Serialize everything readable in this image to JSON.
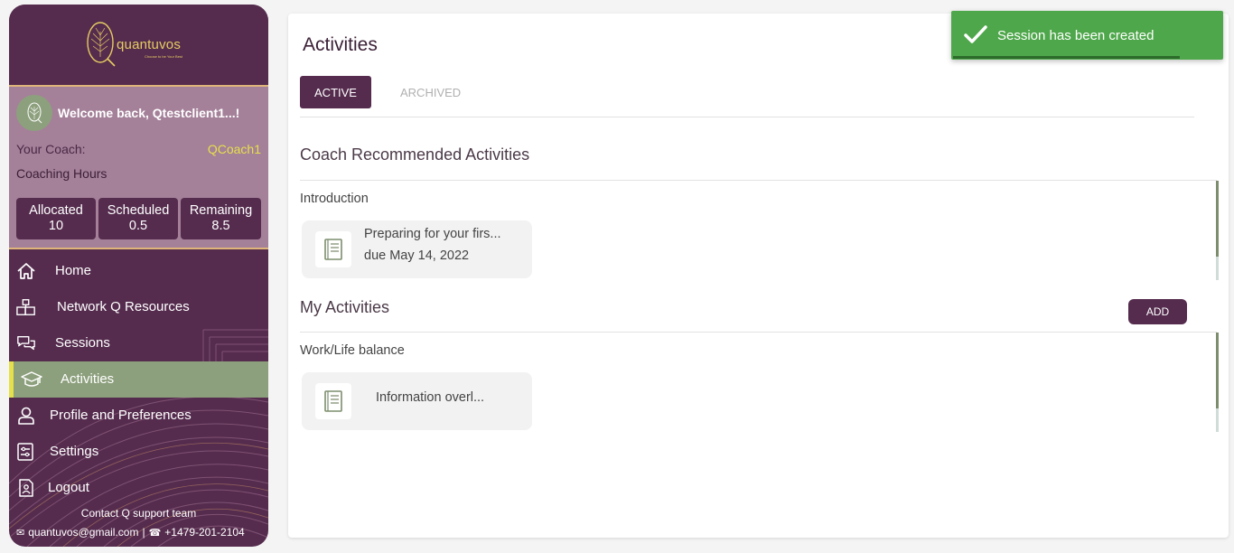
{
  "brand": {
    "logo_text": "quantuvos",
    "tagline": "Choose to be Your Best"
  },
  "user": {
    "welcome": "Welcome back, Qtestclient1...!",
    "coach_label": "Your Coach:",
    "coach_name": "QCoach1",
    "hours_label": "Coaching Hours"
  },
  "stats": [
    {
      "label": "Allocated",
      "value": "10"
    },
    {
      "label": "Scheduled",
      "value": "0.5"
    },
    {
      "label": "Remaining",
      "value": "8.5"
    }
  ],
  "nav": [
    {
      "label": "Home",
      "icon": "home-icon"
    },
    {
      "label": "Network Q Resources",
      "icon": "network-icon"
    },
    {
      "label": "Sessions",
      "icon": "chat-icon"
    },
    {
      "label": "Activities",
      "icon": "graduation-cap-icon",
      "active": true
    },
    {
      "label": "Profile and Preferences",
      "icon": "user-icon"
    },
    {
      "label": "Settings",
      "icon": "settings-icon"
    },
    {
      "label": "Logout",
      "icon": "logout-icon"
    }
  ],
  "contact": {
    "title": "Contact Q support team",
    "email": "quantuvos@gmail.com",
    "phone": "+1479-201-2104"
  },
  "main": {
    "title": "Activities",
    "tabs": [
      "ACTIVE",
      "ARCHIVED"
    ],
    "coach_section": {
      "title": "Coach Recommended Activities",
      "group": "Introduction",
      "card_title": "Preparing for your firs...",
      "card_due": "due May 14, 2022"
    },
    "my_section": {
      "title": "My Activities",
      "add_label": "ADD",
      "group": "Work/Life balance",
      "card_title": "Information overl..."
    }
  },
  "toast": {
    "message": "Session has been created",
    "color": "#4ea74a"
  },
  "colors": {
    "brand_purple": "#552c4e",
    "accent_green": "#8da07d",
    "accent_yellow": "#e6e04c"
  }
}
